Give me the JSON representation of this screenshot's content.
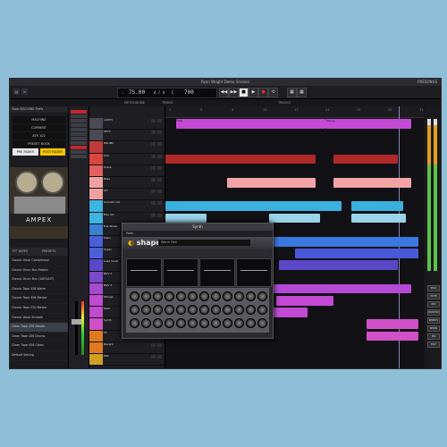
{
  "window": {
    "title": "Ryan Wright Demo Session",
    "right_label": "PRESONUS"
  },
  "transport": {
    "tempo": "75.00",
    "time_sig": "4 / 4",
    "key": "C",
    "position": "700",
    "buttons": [
      "◀◀",
      "▶▶",
      "■",
      "▶",
      "●",
      "⟲"
    ],
    "sub_labels": [
      "METRONOME",
      "TIMING",
      "TRACKS"
    ]
  },
  "browser": {
    "header": "Tape MACHINE Prefs",
    "preset_buttons": [
      "MACHINE",
      "CURRENT",
      "ATR 102",
      "PRESET BOOK",
      "PRE FADER",
      "POST FADER"
    ],
    "brand": "AMPEX",
    "tabs": [
      "FIT TAPES",
      "PRESETS"
    ],
    "presets": [
      "Classic Vocal Compressor",
      "Classic Drum Bus Master",
      "Classic Drum Bus (100%SLT)",
      "Classic Tape 456 Warm",
      "Classic Tape 456 Master",
      "Classic Tape 250 Master",
      "Classic Vocal Smooth",
      "Clean Tape 456 Master",
      "Clean Tape 456 Drums",
      "Clean Tape 456 Clean",
      "Default Setting"
    ],
    "selected_index": 7
  },
  "tracks": [
    {
      "name": "LOOPS",
      "color": "#4a4a55"
    },
    {
      "name": "KEYS",
      "color": "#4a4a55"
    },
    {
      "name": "DRUMS",
      "color": "#c23a3a"
    },
    {
      "name": "Kick",
      "color": "#d9453f"
    },
    {
      "name": "Snare",
      "color": "#e06060"
    },
    {
      "name": "Bass",
      "color": "#f0a0a0"
    },
    {
      "name": "OH",
      "color": "#f0a0a0"
    },
    {
      "name": "Acoustic Gtr",
      "color": "#3eb4e0"
    },
    {
      "name": "Elec Gtr",
      "color": "#3eb4e0"
    },
    {
      "name": "Fret Noise",
      "color": "#3a80d0"
    },
    {
      "name": "Piano",
      "color": "#4a60d8"
    },
    {
      "name": "Organ",
      "color": "#4a60d8"
    },
    {
      "name": "Lead Vocal",
      "color": "#5a48c8"
    },
    {
      "name": "BGV 1",
      "color": "#7a4ac8"
    },
    {
      "name": "BGV 2",
      "color": "#a64ad0"
    },
    {
      "name": "Strings",
      "color": "#c04ad0"
    },
    {
      "name": "Pads",
      "color": "#c04ad0"
    },
    {
      "name": "Synth",
      "color": "#d050c8"
    },
    {
      "name": "FX",
      "color": "#e07a20"
    },
    {
      "name": "Reverb",
      "color": "#e07a20"
    },
    {
      "name": "MIX",
      "color": "#d0a020"
    }
  ],
  "ruler": [
    "1",
    "5",
    "9",
    "13",
    "17",
    "21",
    "25",
    "29",
    "33"
  ],
  "clips": [
    {
      "lane": 0,
      "start": 0.04,
      "end": 0.62,
      "color": "#c44ad6",
      "label": "Fade"
    },
    {
      "lane": 0,
      "start": 0.62,
      "end": 0.95,
      "color": "#c44ad6",
      "label": "Strings"
    },
    {
      "lane": 3,
      "start": 0.0,
      "end": 0.58,
      "color": "#b02828",
      "label": ""
    },
    {
      "lane": 3,
      "start": 0.65,
      "end": 0.9,
      "color": "#b02828",
      "label": ""
    },
    {
      "lane": 5,
      "start": 0.24,
      "end": 0.58,
      "color": "#f2a4a4",
      "label": ""
    },
    {
      "lane": 5,
      "start": 0.65,
      "end": 0.95,
      "color": "#f2a4a4",
      "label": ""
    },
    {
      "lane": 7,
      "start": 0.0,
      "end": 0.68,
      "color": "#3ab0dd",
      "label": ""
    },
    {
      "lane": 7,
      "start": 0.72,
      "end": 0.92,
      "color": "#3ab0dd",
      "label": ""
    },
    {
      "lane": 8,
      "start": 0.0,
      "end": 0.16,
      "color": "#9ad4ea",
      "label": ""
    },
    {
      "lane": 8,
      "start": 0.4,
      "end": 0.6,
      "color": "#9ad4ea",
      "label": ""
    },
    {
      "lane": 8,
      "start": 0.72,
      "end": 0.93,
      "color": "#9ad4ea",
      "label": ""
    },
    {
      "lane": 10,
      "start": 0.0,
      "end": 0.98,
      "color": "#3a78e0",
      "label": ""
    },
    {
      "lane": 11,
      "start": 0.5,
      "end": 0.98,
      "color": "#4a58d8",
      "label": ""
    },
    {
      "lane": 12,
      "start": 0.44,
      "end": 0.9,
      "color": "#5a48c8",
      "label": ""
    },
    {
      "lane": 14,
      "start": 0.42,
      "end": 0.95,
      "color": "#b44ad6",
      "label": ""
    },
    {
      "lane": 15,
      "start": 0.43,
      "end": 0.65,
      "color": "#c44ad6",
      "label": ""
    },
    {
      "lane": 16,
      "start": 0.38,
      "end": 0.55,
      "color": "#c44ad6",
      "label": ""
    },
    {
      "lane": 17,
      "start": 0.78,
      "end": 0.98,
      "color": "#d050c8",
      "label": ""
    },
    {
      "lane": 18,
      "start": 0.78,
      "end": 0.98,
      "color": "#d050c8",
      "label": ""
    }
  ],
  "plugin": {
    "title": "Synth",
    "track": "Pads",
    "name": "shape",
    "preset": "Warm Pad"
  },
  "right_buttons": [
    "SOLO",
    "MUTE",
    "REC",
    "MONITOR",
    "INSERTS",
    "SENDS",
    "MIX",
    "EDIT"
  ]
}
